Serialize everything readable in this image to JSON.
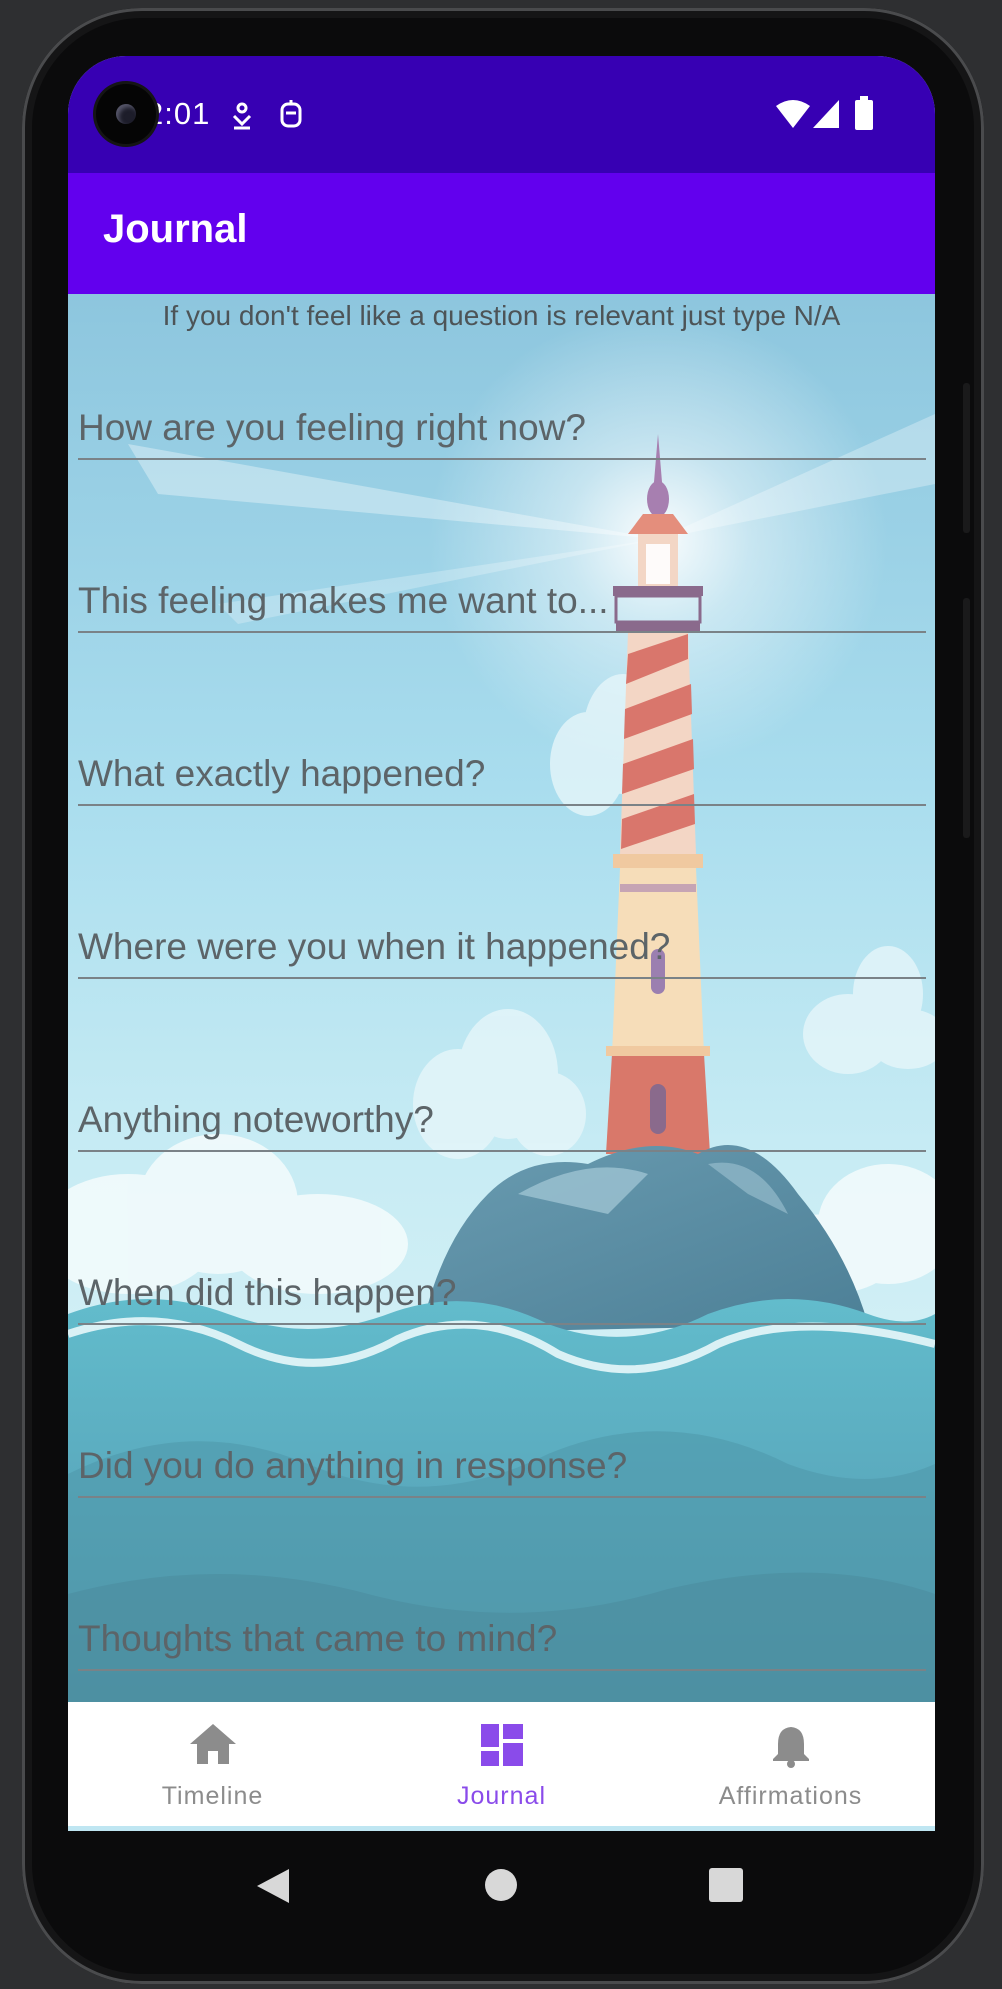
{
  "status_bar": {
    "time": "2:01",
    "icons_left": [
      "notification-download-icon",
      "notification-robot-icon"
    ],
    "icons_right": [
      "wifi-icon",
      "cell-signal-icon",
      "battery-icon"
    ]
  },
  "app_bar": {
    "title": "Journal"
  },
  "content": {
    "hint": "If you don't feel like a question is relevant just type N/A",
    "fields": [
      {
        "placeholder": "How are you feeling right now?"
      },
      {
        "placeholder": "This feeling makes me want to..."
      },
      {
        "placeholder": "What exactly happened?"
      },
      {
        "placeholder": "Where were you when it happened?"
      },
      {
        "placeholder": "Anything noteworthy?"
      },
      {
        "placeholder": "When did this happen?"
      },
      {
        "placeholder": "Did you do anything in response?"
      },
      {
        "placeholder": "Thoughts that came to mind?"
      }
    ]
  },
  "bottom_nav": {
    "items": [
      {
        "label": "Timeline",
        "icon": "home-icon",
        "active": false
      },
      {
        "label": "Journal",
        "icon": "dashboard-icon",
        "active": true
      },
      {
        "label": "Affirmations",
        "icon": "bell-icon",
        "active": false
      }
    ],
    "active_color": "#8a4bea",
    "inactive_color": "#8c8c8c"
  },
  "colors": {
    "status_bar": "#3700b3",
    "app_bar": "#6200ee"
  }
}
